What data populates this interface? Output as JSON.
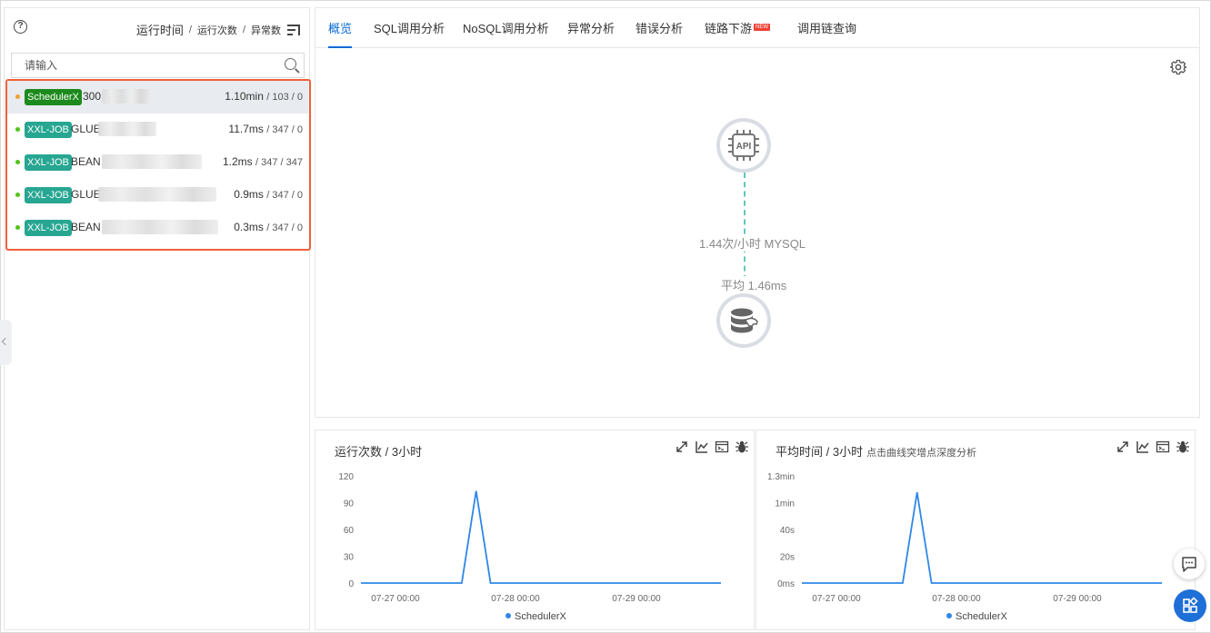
{
  "left": {
    "help_icon_text": "?",
    "sort": {
      "run_time": "运行时间",
      "sep": "/",
      "run_count": "运行次数",
      "errors": "异常数"
    },
    "search": {
      "placeholder": "请输入"
    },
    "jobs": [
      {
        "badge": "SchedulerX",
        "badge_color": "#1c8a1c",
        "dot_color": "#f0a030",
        "name": "300",
        "time": "1.10min",
        "counts": "/ 103 / 0",
        "selected": true
      },
      {
        "badge": "XXL-JOB",
        "badge_color": "#27a692",
        "dot_color": "#52c41a",
        "name": "GLUE",
        "time": "11.7ms",
        "counts": "/ 347 / 0"
      },
      {
        "badge": "XXL-JOB",
        "badge_color": "#27a692",
        "dot_color": "#52c41a",
        "name": "BEAN",
        "time": "1.2ms",
        "counts": "/ 347 / 347"
      },
      {
        "badge": "XXL-JOB",
        "badge_color": "#27a692",
        "dot_color": "#52c41a",
        "name": "GLUE",
        "time": "0.9ms",
        "counts": "/ 347 / 0"
      },
      {
        "badge": "XXL-JOB",
        "badge_color": "#27a692",
        "dot_color": "#52c41a",
        "name": "BEAN",
        "time": "0.3ms",
        "counts": "/ 347 / 0"
      }
    ]
  },
  "tabs": [
    {
      "label": "概览",
      "active": true
    },
    {
      "label": "SQL调用分析"
    },
    {
      "label": "NoSQL调用分析"
    },
    {
      "label": "异常分析"
    },
    {
      "label": "错误分析"
    },
    {
      "label": "链路下游",
      "badge": "NEW"
    },
    {
      "label": "调用链查询"
    }
  ],
  "topology": {
    "api_label": "API",
    "edge_rate": "1.44次/小时 MYSQL",
    "edge_avg": "平均 1.46ms",
    "edge_color": "#5fc8b6"
  },
  "charts": [
    {
      "title": "运行次数 / 3小时",
      "subtitle": "",
      "legend": "SchedulerX",
      "chart_data": {
        "type": "line",
        "x": [
          "07-27 00:00",
          "07-28 00:00",
          "07-29 00:00"
        ],
        "yticks": [
          "0",
          "30",
          "60",
          "90",
          "120"
        ],
        "ylim": [
          0,
          120
        ],
        "series": [
          {
            "name": "SchedulerX",
            "color": "#2f87e8",
            "values": [
              0,
              0,
              0,
              0,
              0,
              0,
              0,
              0,
              103,
              0,
              0,
              0,
              0,
              0,
              0,
              0,
              0,
              0,
              0,
              0,
              0,
              0,
              0,
              0,
              0,
              0
            ]
          }
        ]
      }
    },
    {
      "title": "平均时间 / 3小时",
      "subtitle": "点击曲线突增点深度分析",
      "legend": "SchedulerX",
      "chart_data": {
        "type": "line",
        "x": [
          "07-27 00:00",
          "07-28 00:00",
          "07-29 00:00"
        ],
        "yticks": [
          "0ms",
          "20s",
          "40s",
          "1min",
          "1.3min"
        ],
        "ylim": [
          0,
          1.3
        ],
        "series": [
          {
            "name": "SchedulerX",
            "color": "#2f87e8",
            "values": [
              0,
              0,
              0,
              0,
              0,
              0,
              0,
              0,
              1.1,
              0,
              0,
              0,
              0,
              0,
              0,
              0,
              0,
              0,
              0,
              0,
              0,
              0,
              0,
              0,
              0,
              0
            ]
          }
        ]
      }
    }
  ],
  "colors": {
    "accent": "#0a6bd6",
    "highlight_border": "#f0603a",
    "fab": "#1f6fd8"
  }
}
